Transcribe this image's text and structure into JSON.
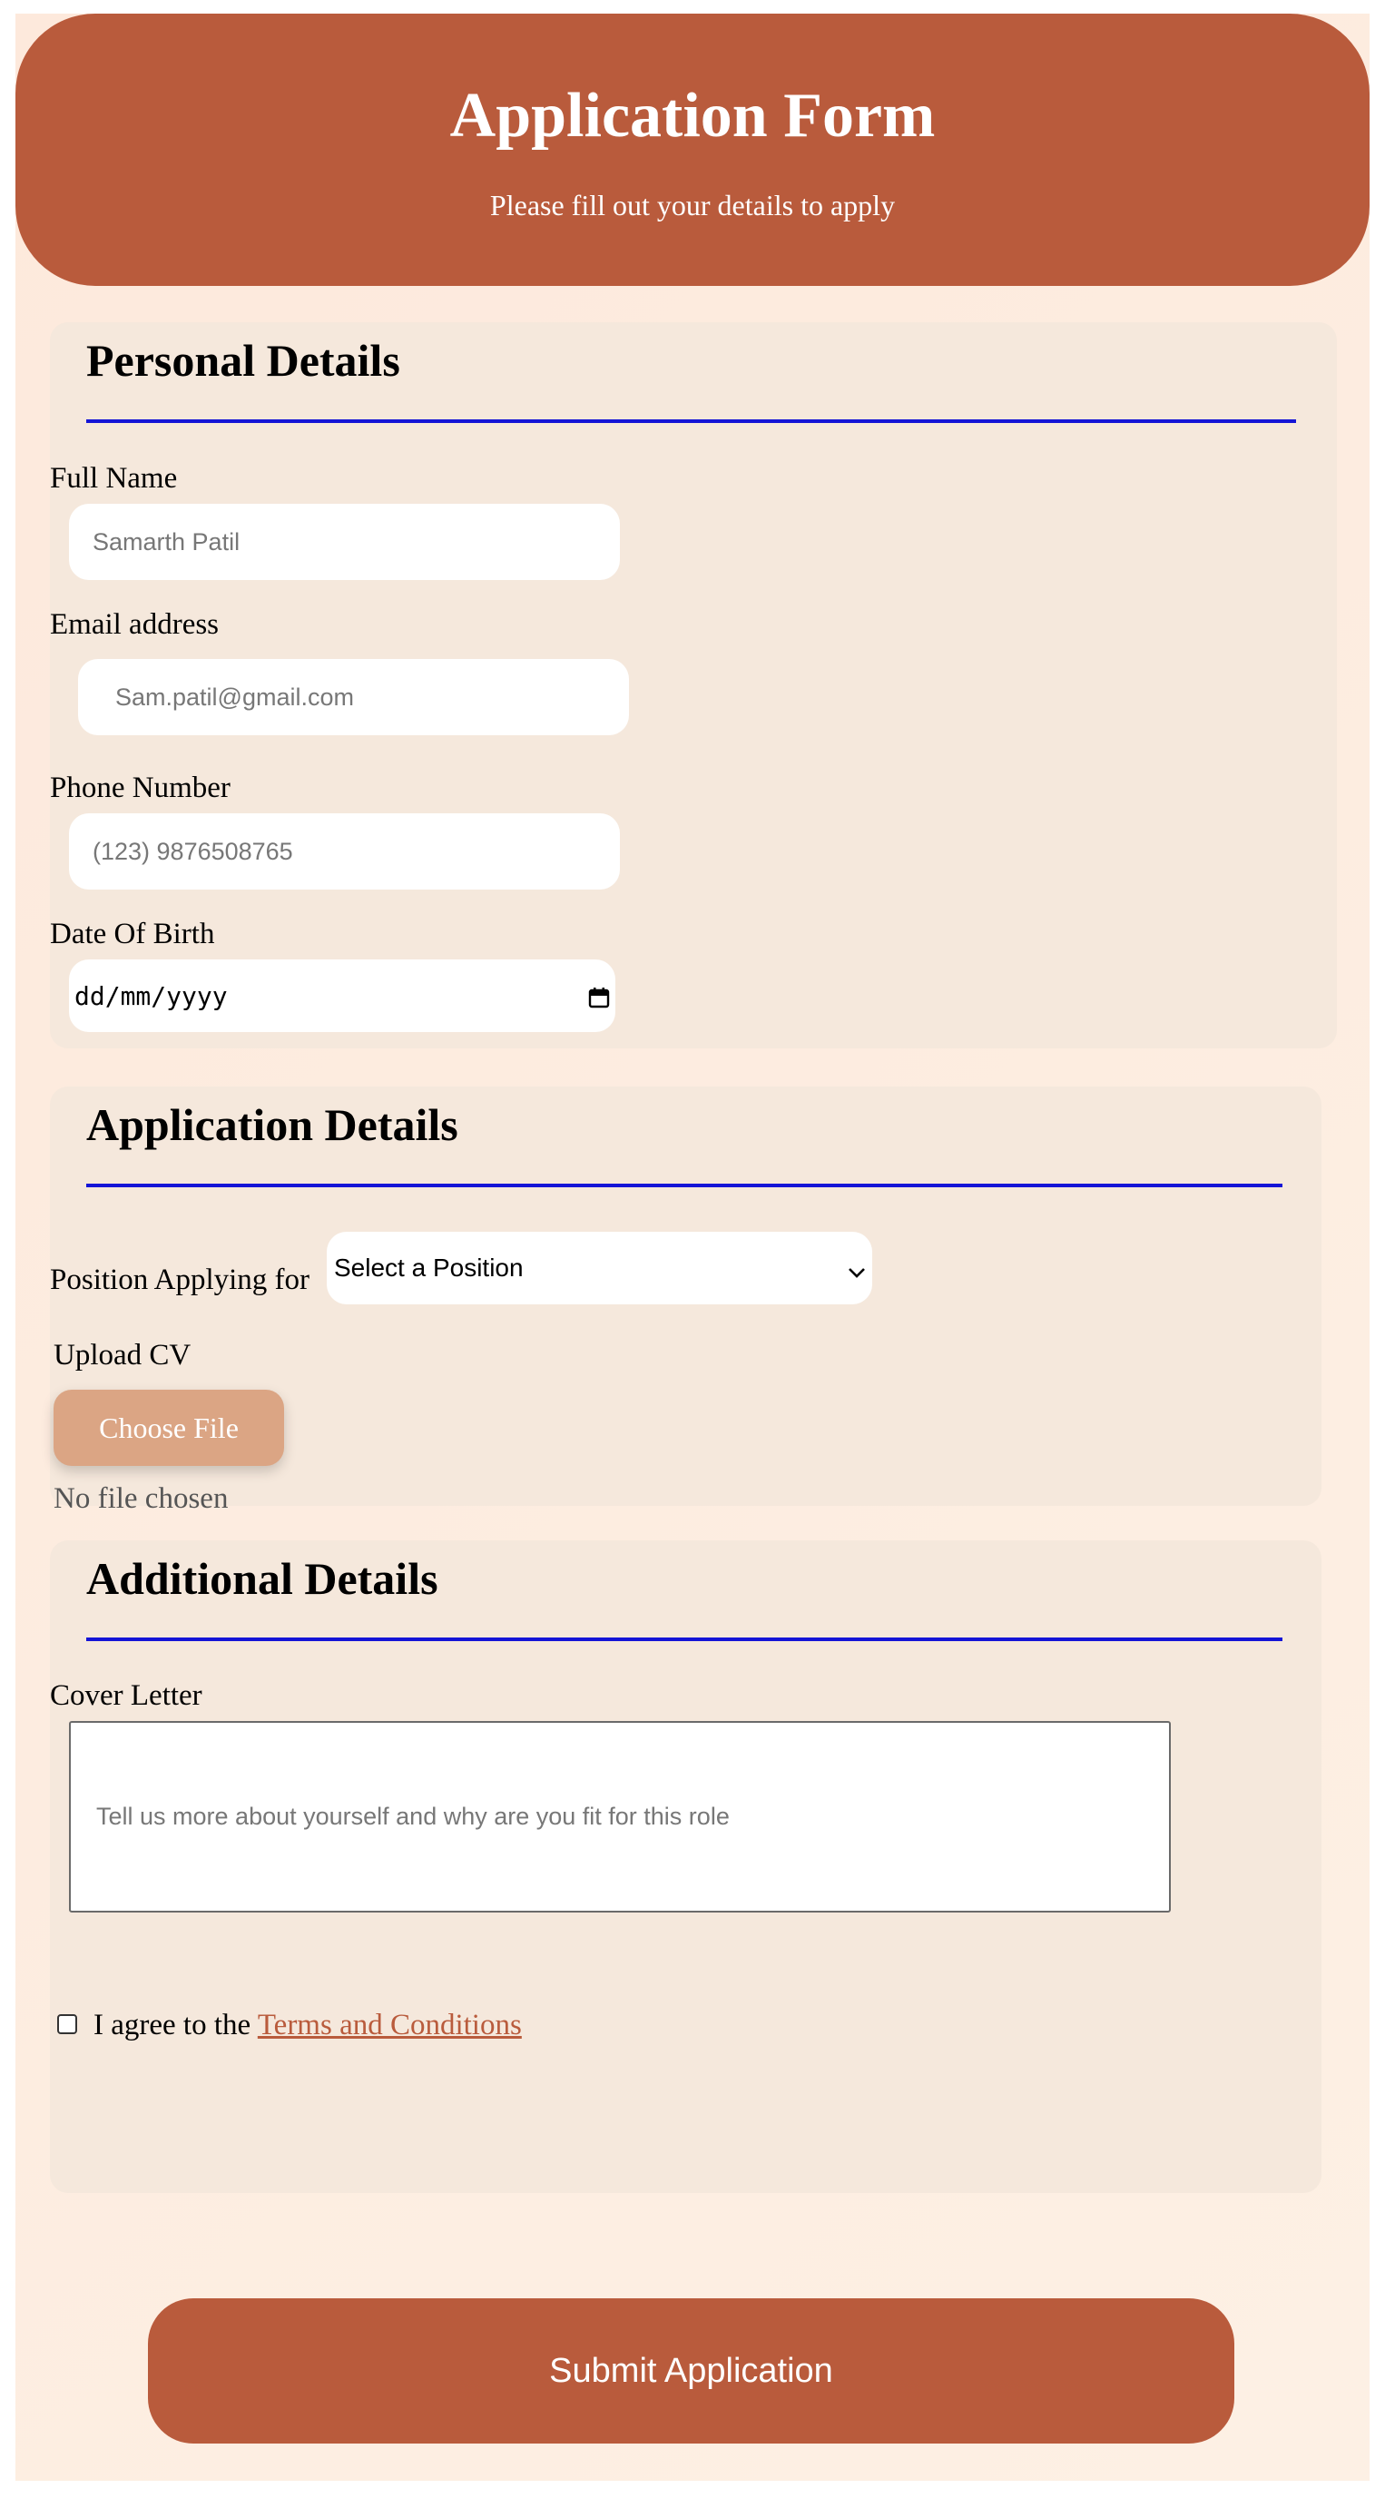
{
  "header": {
    "title": "Application Form",
    "subtitle": "Please fill out your details to apply"
  },
  "personal": {
    "heading": "Personal Details",
    "full_name_label": "Full Name",
    "full_name_placeholder": "Samarth Patil",
    "email_label": "Email address",
    "email_prefix": ".",
    "email_placeholder": "Sam.patil@gmail.com",
    "phone_label": "Phone Number",
    "phone_placeholder": "(123) 9876508765",
    "dob_label": "Date Of Birth",
    "dob_placeholder": "dd/mm/yyyy"
  },
  "application": {
    "heading": "Application Details",
    "position_label": "Position Applying for",
    "position_selected": "Select a Position",
    "upload_label": "Upload CV",
    "choose_file_label": "Choose File",
    "no_file_text": "No file chosen"
  },
  "additional": {
    "heading": "Additional Details",
    "cover_letter_label": "Cover Letter",
    "cover_letter_placeholder": "Tell us more about yourself and why are you fit for this role",
    "agree_text": "I agree to the ",
    "terms_link": "Terms and Conditions"
  },
  "submit_label": "Submit Application",
  "colors": {
    "accent": "#b95b3c",
    "button_light": "#dba584",
    "section_bg": "#f5e8dc",
    "rule": "#1414d6"
  }
}
